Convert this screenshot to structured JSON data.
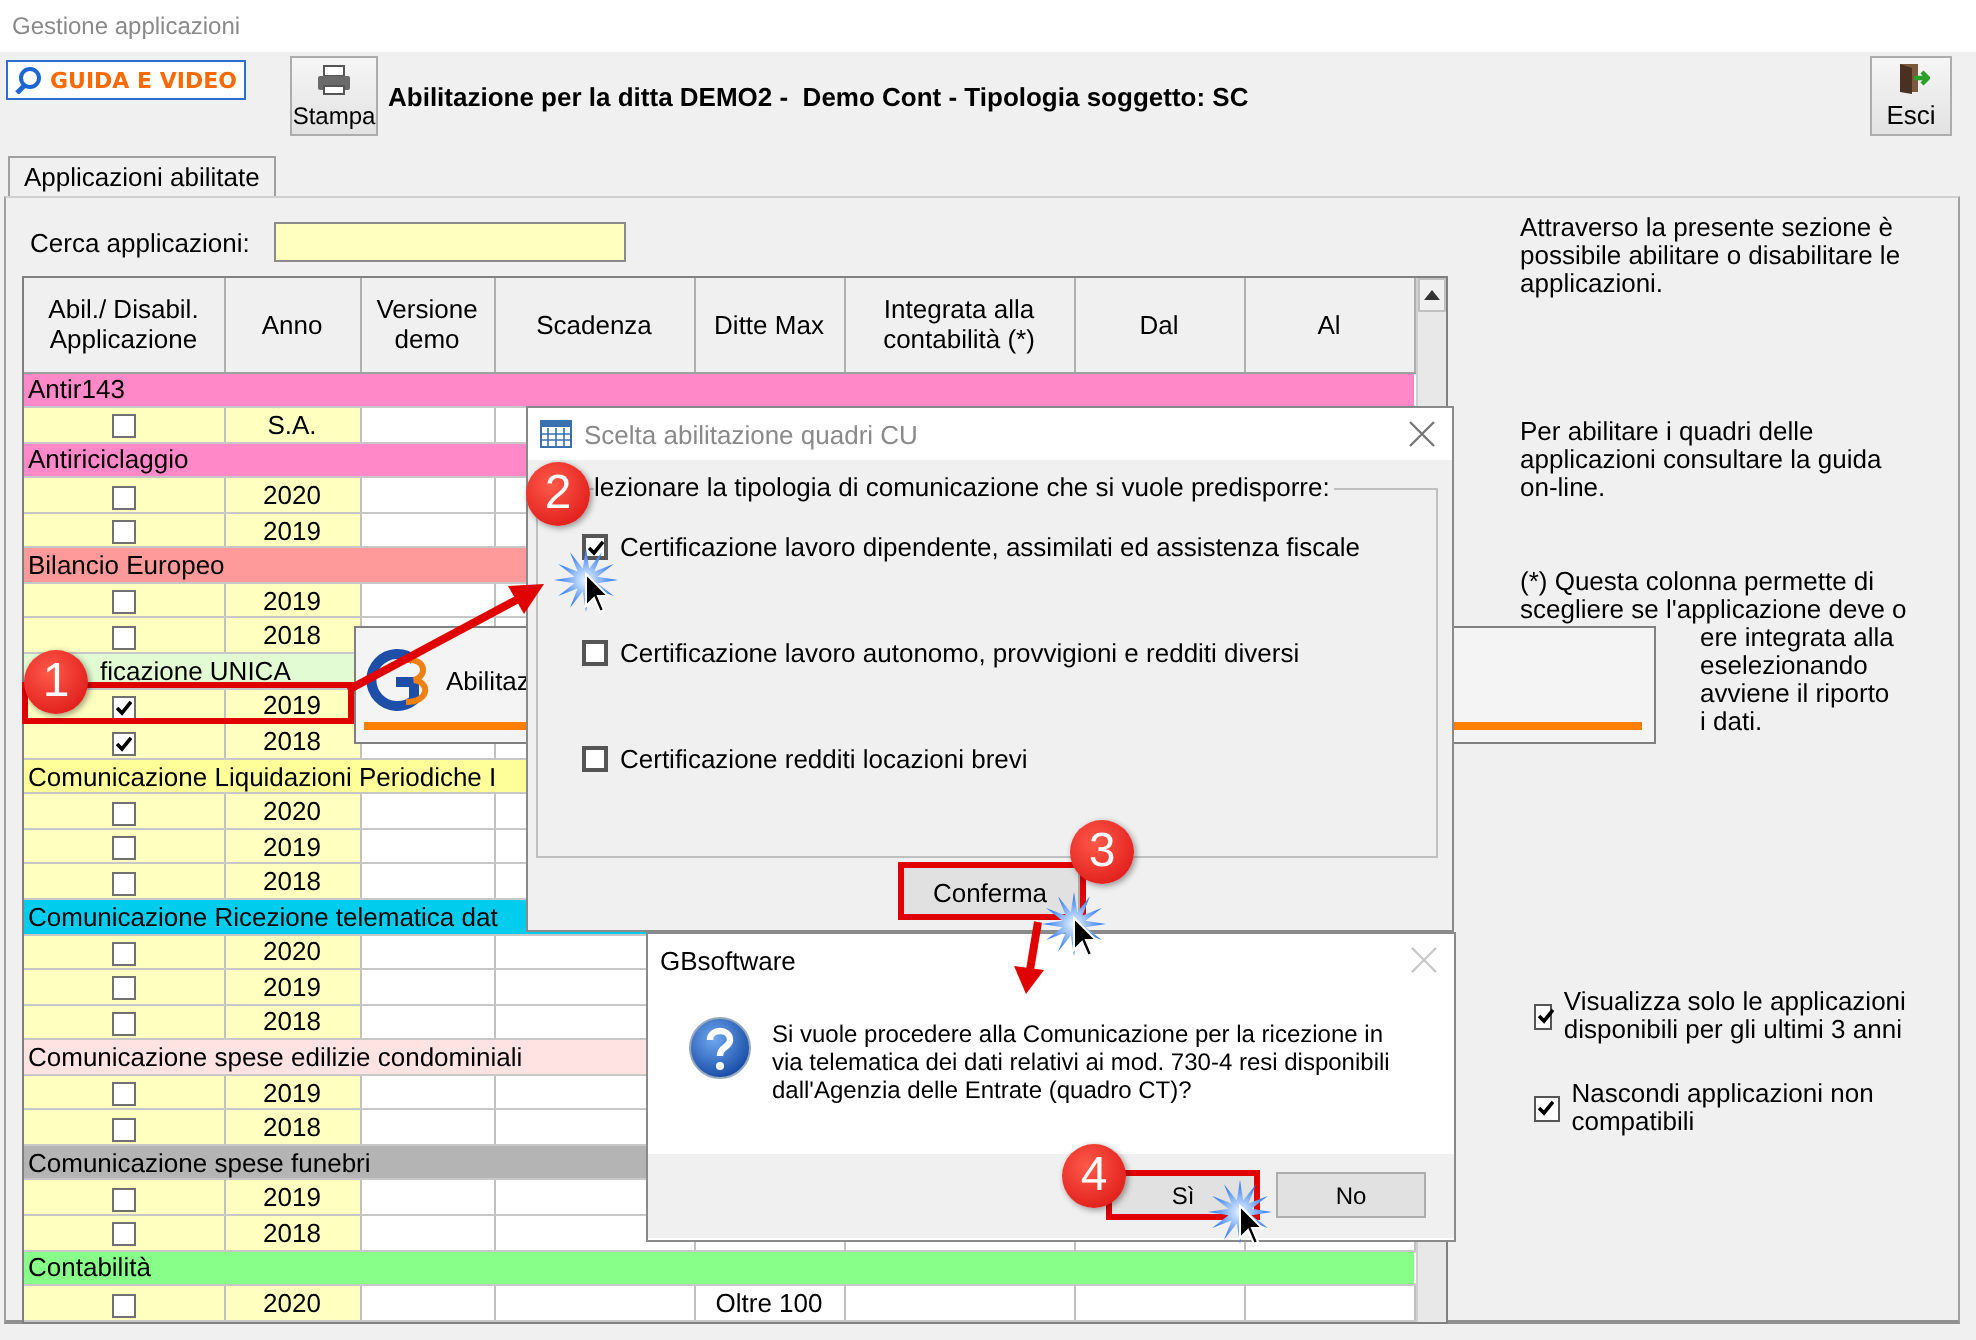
{
  "window": {
    "title": "Gestione applicazioni"
  },
  "toolbar": {
    "guide_button": "GUIDA E VIDEO",
    "print_button": "Stampa",
    "heading": "Abilitazione per la ditta DEMO2 -  Demo Cont - Tipologia soggetto: SC",
    "exit_button": "Esci"
  },
  "tabs": [
    {
      "label": "Applicazioni abilitate",
      "selected": true
    }
  ],
  "search": {
    "label": "Cerca applicazioni:"
  },
  "table": {
    "columns": [
      "Abil./ Disabil. Applicazione",
      "Anno",
      "Versione demo",
      "Scadenza",
      "Ditte Max",
      "Integrata alla contabilità (*)",
      "Dal",
      "Al"
    ],
    "groups": [
      {
        "name": "Antir143",
        "color": "#ff88c8",
        "lead_covered": false,
        "rows": [
          {
            "checked": false,
            "year": "S.A."
          }
        ]
      },
      {
        "name": "Antiriciclaggio",
        "color": "#ff88c8",
        "lead_covered": false,
        "rows": [
          {
            "checked": false,
            "year": "2020"
          },
          {
            "checked": false,
            "year": "2019"
          }
        ]
      },
      {
        "name": "Bilancio Europeo",
        "color": "#ff9a9a",
        "lead_covered": false,
        "rows": [
          {
            "checked": false,
            "year": "2019"
          },
          {
            "checked": false,
            "year": "2018"
          }
        ]
      },
      {
        "name": "ficazione UNICA",
        "color": "#e2fbd2",
        "lead_covered": true,
        "rows": [
          {
            "checked": true,
            "year": "2019"
          },
          {
            "checked": true,
            "year": "2018"
          }
        ]
      },
      {
        "name": "Comunicazione Liquidazioni Periodiche I",
        "color": "#ffff99",
        "lead_covered": false,
        "rows": [
          {
            "checked": false,
            "year": "2020"
          },
          {
            "checked": false,
            "year": "2019"
          },
          {
            "checked": false,
            "year": "2018"
          }
        ]
      },
      {
        "name": "Comunicazione Ricezione telematica dat",
        "color": "#00ccee",
        "lead_covered": false,
        "rows": [
          {
            "checked": false,
            "year": "2020"
          },
          {
            "checked": false,
            "year": "2019"
          },
          {
            "checked": false,
            "year": "2018"
          }
        ]
      },
      {
        "name": "Comunicazione spese edilizie condominiali",
        "color": "#ffe2e2",
        "lead_covered": false,
        "rows": [
          {
            "checked": false,
            "year": "2019"
          },
          {
            "checked": false,
            "year": "2018"
          }
        ]
      },
      {
        "name": "Comunicazione spese funebri",
        "color": "#b4b4b4",
        "lead_covered": false,
        "rows": [
          {
            "checked": false,
            "year": "2019"
          },
          {
            "checked": false,
            "year": "2018"
          }
        ]
      },
      {
        "name": "Contabilità",
        "color": "#88ff88",
        "lead_covered": false,
        "rows": [
          {
            "checked": false,
            "year": "2020",
            "ditte_max": "Oltre 100"
          }
        ]
      }
    ]
  },
  "right_panel": {
    "paragraphs": [
      "Attraverso la presente sezione è possibile abilitare o disabilitare le applicazioni.",
      "Per abilitare i quadri delle applicazioni consultare la guida on-line."
    ],
    "note_lines": [
      {
        "text": "(*) Questa colonna permette di",
        "kind": "full"
      },
      {
        "text": "scegliere se l'applicazione deve o",
        "kind": "full"
      },
      {
        "text": "ere integrata alla",
        "kind": "covered"
      },
      {
        "text": "eselezionando",
        "kind": "covered"
      },
      {
        "text": "avviene il riporto",
        "kind": "covered"
      },
      {
        "text": "i dati.",
        "kind": "covered"
      }
    ],
    "options": [
      {
        "label": "Visualizza solo le applicazioni disponibili per gli ultimi 3 anni",
        "checked": true
      },
      {
        "label": "Nascondi applicazioni non compatibili",
        "checked": true
      }
    ]
  },
  "popup": {
    "text": "Abilitaz"
  },
  "dialog_cu": {
    "title": "Scelta abilitazione quadri CU",
    "legend": "lezionare la tipologia di comunicazione che si vuole predisporre:",
    "options": [
      {
        "label": "Certificazione lavoro dipendente, assimilati ed assistenza fiscale",
        "checked": true
      },
      {
        "label": "Certificazione lavoro autonomo, provvigioni e redditi diversi",
        "checked": false
      },
      {
        "label": "Certificazione redditi locazioni brevi",
        "checked": false
      }
    ],
    "confirm": "Conferma"
  },
  "dialog_msg": {
    "title": "GBsoftware",
    "message": "Si vuole procedere alla Comunicazione per la ricezione in via telematica dei dati relativi ai mod. 730-4 resi disponibili dall'Agenzia delle Entrate (quadro CT)?",
    "buttons": [
      "Sì",
      "No"
    ]
  },
  "annotations": {
    "badges": [
      "1",
      "2",
      "3",
      "4"
    ]
  }
}
